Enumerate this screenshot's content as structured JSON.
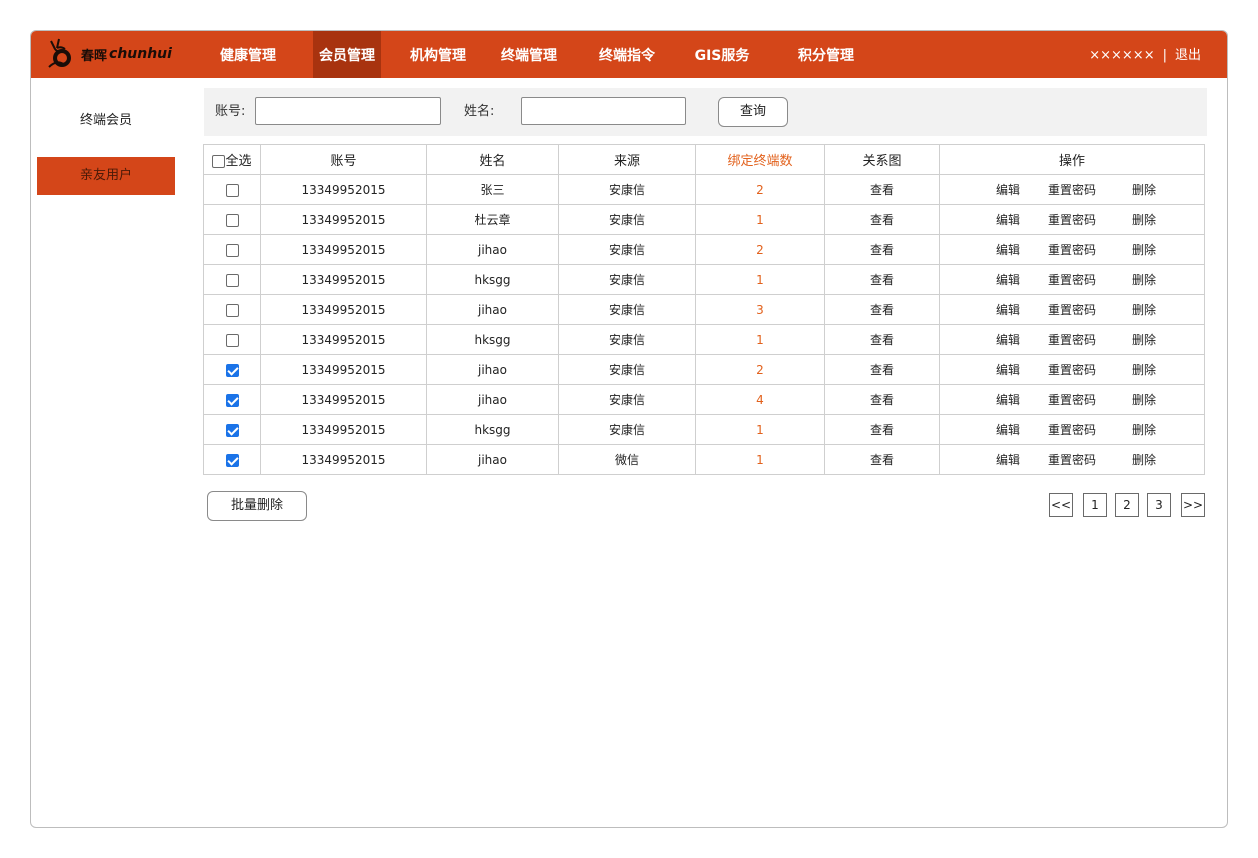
{
  "header": {
    "logo_cn": "春晖",
    "logo_en": "chunhui",
    "nav": [
      {
        "label": "健康管理",
        "active": false
      },
      {
        "label": "会员管理",
        "active": true
      },
      {
        "label": "机构管理",
        "active": false
      },
      {
        "label": "终端管理",
        "active": false
      },
      {
        "label": "终端指令",
        "active": false
      },
      {
        "label": "GIS服务",
        "active": false
      },
      {
        "label": "积分管理",
        "active": false
      }
    ],
    "username": "××××××",
    "separator": "|",
    "logout": "退出"
  },
  "sidebar": {
    "items": [
      {
        "label": "终端会员",
        "active": false
      },
      {
        "label": "亲友用户",
        "active": true
      }
    ]
  },
  "search": {
    "account_label": "账号:",
    "account_value": "",
    "name_label": "姓名:",
    "name_value": "",
    "query_button": "查询"
  },
  "table": {
    "select_all_label": "全选",
    "select_all_checked": false,
    "headers": [
      "账号",
      "姓名",
      "来源",
      "绑定终端数",
      "关系图",
      "操作"
    ],
    "rows": [
      {
        "checked": false,
        "account": "13349952015",
        "name": "张三",
        "source": "安康信",
        "count": "2",
        "view": "查看"
      },
      {
        "checked": false,
        "account": "13349952015",
        "name": "杜云章",
        "source": "安康信",
        "count": "1",
        "view": "查看"
      },
      {
        "checked": false,
        "account": "13349952015",
        "name": "jihao",
        "source": "安康信",
        "count": "2",
        "view": "查看"
      },
      {
        "checked": false,
        "account": "13349952015",
        "name": "hksgg",
        "source": "安康信",
        "count": "1",
        "view": "查看"
      },
      {
        "checked": false,
        "account": "13349952015",
        "name": "jihao",
        "source": "安康信",
        "count": "3",
        "view": "查看"
      },
      {
        "checked": false,
        "account": "13349952015",
        "name": "hksgg",
        "source": "安康信",
        "count": "1",
        "view": "查看"
      },
      {
        "checked": true,
        "account": "13349952015",
        "name": "jihao",
        "source": "安康信",
        "count": "2",
        "view": "查看"
      },
      {
        "checked": true,
        "account": "13349952015",
        "name": "jihao",
        "source": "安康信",
        "count": "4",
        "view": "查看"
      },
      {
        "checked": true,
        "account": "13349952015",
        "name": "hksgg",
        "source": "安康信",
        "count": "1",
        "view": "查看"
      },
      {
        "checked": true,
        "account": "13349952015",
        "name": "jihao",
        "source": "微信",
        "count": "1",
        "view": "查看"
      }
    ],
    "actions": {
      "edit": "编辑",
      "reset": "重置密码",
      "delete": "删除"
    }
  },
  "footer": {
    "batch_delete": "批量删除",
    "pagination": [
      "<<",
      "1",
      "2",
      "3",
      ">>"
    ]
  },
  "colors": {
    "brand": "#d44619",
    "brand_dark": "#a8330f",
    "accent_text": "#e2611c",
    "checkbox": "#1a73e8"
  }
}
